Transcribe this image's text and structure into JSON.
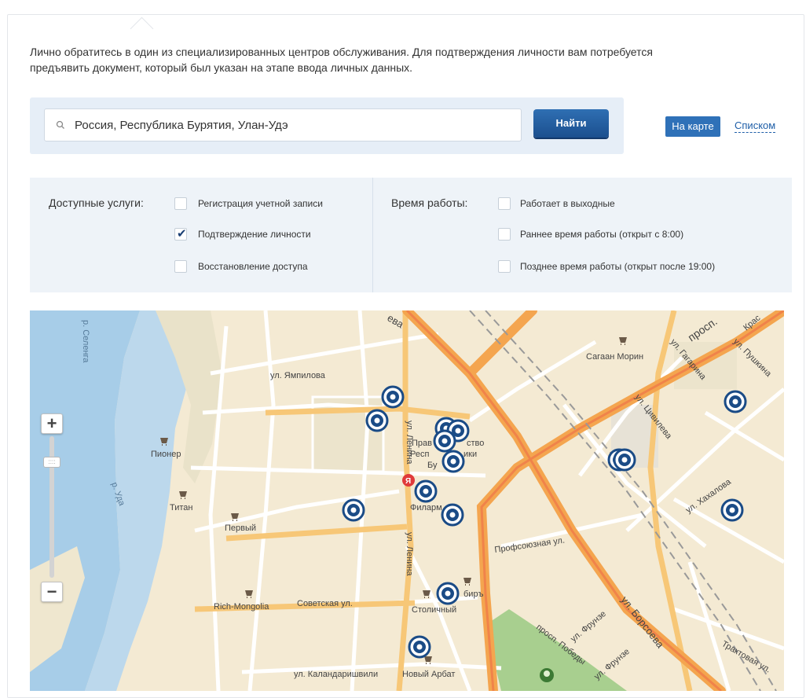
{
  "intro": {
    "line1": "Лично обратитесь в один из специализированных центров обслуживания. Для подтверждения личности вам потребуется",
    "line2": "предъявить документ, который был указан на этапе ввода личных данных."
  },
  "search": {
    "value": "Россия, Республика Бурятия, Улан-Удэ",
    "button_label": "Найти"
  },
  "view": {
    "map_label": "На карте",
    "list_label": "Списком",
    "active": "map"
  },
  "filters": {
    "services_label": "Доступные услуги:",
    "services": [
      {
        "label": "Регистрация учетной записи",
        "checked": false
      },
      {
        "label": "Подтверждение личности",
        "checked": true
      },
      {
        "label": "Восстановление доступа",
        "checked": false
      }
    ],
    "hours_label": "Время работы:",
    "hours": [
      {
        "label": "Работает в выходные",
        "checked": false
      },
      {
        "label": "Раннее время работы (открыт с 8:00)",
        "checked": false
      },
      {
        "label": "Позднее время работы (открыт после 19:00)",
        "checked": false
      }
    ]
  },
  "map": {
    "zoom_in": "+",
    "zoom_out": "−",
    "colors": {
      "land": "#f4ead3",
      "water": "#a7cde8",
      "road_main": "#f7b35c",
      "road": "#ffffff",
      "park": "#a8cf8f",
      "marker": "#1a4b86"
    },
    "labels": {
      "street_yampilova": "ул. Ямпилова",
      "street_lenina_1": "ул. Ленина",
      "street_lenina_2": "ул. Ленина",
      "street_sovetskaya": "Советская ул.",
      "street_kalandarishvili": "ул. Каландаришвили",
      "street_profsoyuznaya": "Профсоюзная ул.",
      "street_borsoeva": "ул. Борсоева",
      "street_tsivileva": "ул. Цивилева",
      "street_khakhalova": "ул. Хахалова",
      "street_pushkina": "ул. Пушкина",
      "street_gagarina": "ул. Гагарина",
      "street_frunze_1": "ул. Фрунзе",
      "street_frunze_2": "ул. Фрунзе",
      "street_traktovaya": "Трактовая ул.",
      "prospect_pobedy": "просп. Победы",
      "prospect": "просп.",
      "krasn": "Крас",
      "river_selenga": "р. Селенга",
      "river_uda": "р. Уда",
      "poi_pioner": "Пионер",
      "poi_titan": "Титан",
      "poi_perviy": "Первый",
      "poi_rich": "Rich-Mongolia",
      "poi_stolichny": "Столичный",
      "poi_arbat": "Новый Арбат",
      "poi_sagaan": "Сагаан Морин",
      "poi_filarm": "Филарм",
      "poi_birj": "биръ",
      "govt_1": "Прав",
      "govt_1b": "ство",
      "govt_2": "Респ",
      "govt_2b": "ики",
      "govt_3": "Бу",
      "street_top": "ева"
    }
  }
}
